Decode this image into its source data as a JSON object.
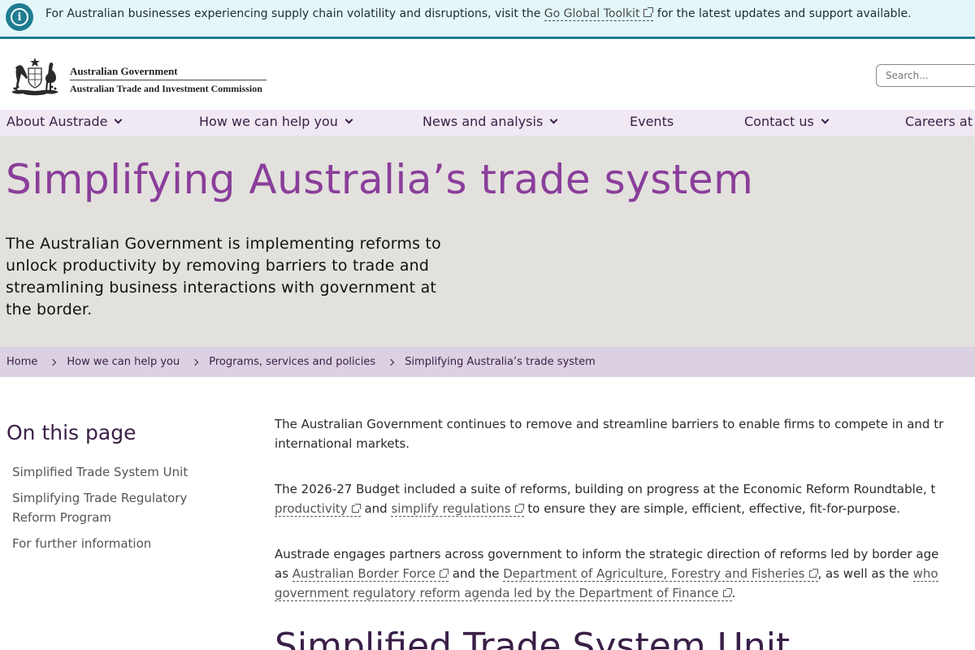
{
  "alert": {
    "text_before": "For Australian businesses experiencing supply chain volatility and disruptions, visit the",
    "link": "Go Global Toolkit",
    "text_after": "for the latest updates and support available."
  },
  "header": {
    "gov_name": "Australian Government",
    "agency_name": "Australian Trade and Investment Commission",
    "search_placeholder": "Search..."
  },
  "nav": {
    "items": [
      {
        "label": "About Austrade",
        "has_dropdown": true
      },
      {
        "label": "How we can help you",
        "has_dropdown": true
      },
      {
        "label": "News and analysis",
        "has_dropdown": true
      },
      {
        "label": "Events",
        "has_dropdown": false
      },
      {
        "label": "Contact us",
        "has_dropdown": true
      },
      {
        "label": "Careers at",
        "has_dropdown": false
      }
    ]
  },
  "hero": {
    "title": "Simplifying Australia’s trade system",
    "intro": "The Australian Government is implementing reforms to unlock productivity by removing barriers to trade and streamlining business interactions with government at the border."
  },
  "breadcrumb": [
    "Home",
    "How we can help you",
    "Programs, services and policies",
    "Simplifying Australia’s trade system"
  ],
  "sidebar": {
    "title": "On this page",
    "links": [
      "Simplified Trade System Unit",
      "Simplifying Trade Regulatory Reform Program",
      "For further information"
    ]
  },
  "content": {
    "p1_line1": "The Australian Government continues to remove and streamline barriers to enable firms to compete in and tr",
    "p1_line2": "international markets.",
    "p2_line1": "The 2026-27 Budget included a suite of reforms, building on progress at the Economic Reform Roundtable, t",
    "p2_link1": "productivity",
    "p2_mid": "and",
    "p2_link2": "simplify regulations",
    "p2_end": "to ensure they are simple, efficient, effective, fit-for-purpose.",
    "p3_line1": "Austrade engages partners across government to inform the strategic direction of reforms led by border age",
    "p3_as": "as",
    "p3_link1": "Australian Border Force",
    "p3_and": "and the",
    "p3_link2": "Department of Agriculture, Forestry and Fisheries",
    "p3_aswell": ", as well as the",
    "p3_link3a": "who",
    "p3_link3b": "government regulatory reform agenda led by the Department of Finance",
    "p3_end": ".",
    "section_title": "Simplified Trade System Unit"
  },
  "colors": {
    "banner_bg": "#e3f7fb",
    "banner_accent": "#1f7c91",
    "nav_bg": "#f0e8f3",
    "hero_bg": "#e3e1dd",
    "hero_title": "#8a3e9b",
    "breadcrumb_bg": "#dcd1e2",
    "heading": "#3a1f47"
  }
}
